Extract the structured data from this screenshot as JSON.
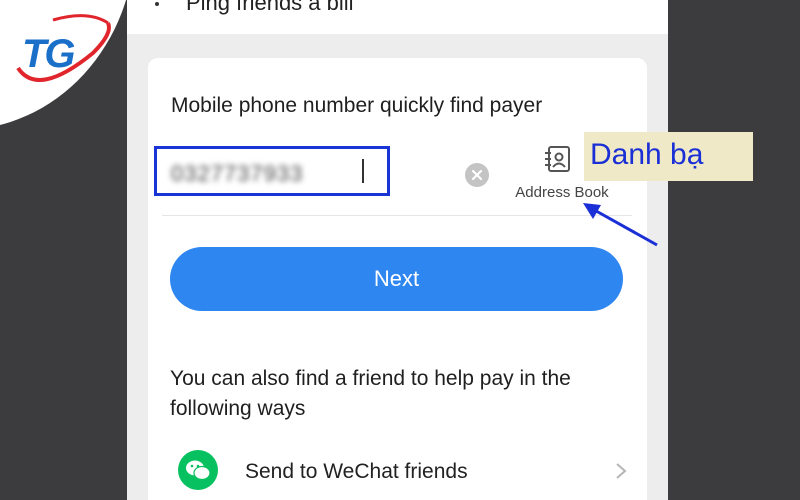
{
  "top_item": {
    "text": "Ping friends a bill"
  },
  "logo": {
    "text": "TG"
  },
  "find_payer": {
    "title": "Mobile phone number quickly find payer",
    "input_value": "0327737933",
    "address_book_label": "Address Book"
  },
  "next_button": {
    "label": "Next"
  },
  "alternatives": {
    "heading": "You can also find a friend to help pay in the following ways",
    "items": [
      {
        "label": "Send to WeChat friends",
        "icon": "wechat-icon"
      }
    ]
  },
  "annotation": {
    "text": "Danh bạ"
  },
  "colors": {
    "accent_blue": "#2e86f0",
    "highlight_border": "#1a35d6",
    "wechat_green": "#07c160",
    "annotation_text": "#1a2fd6"
  }
}
